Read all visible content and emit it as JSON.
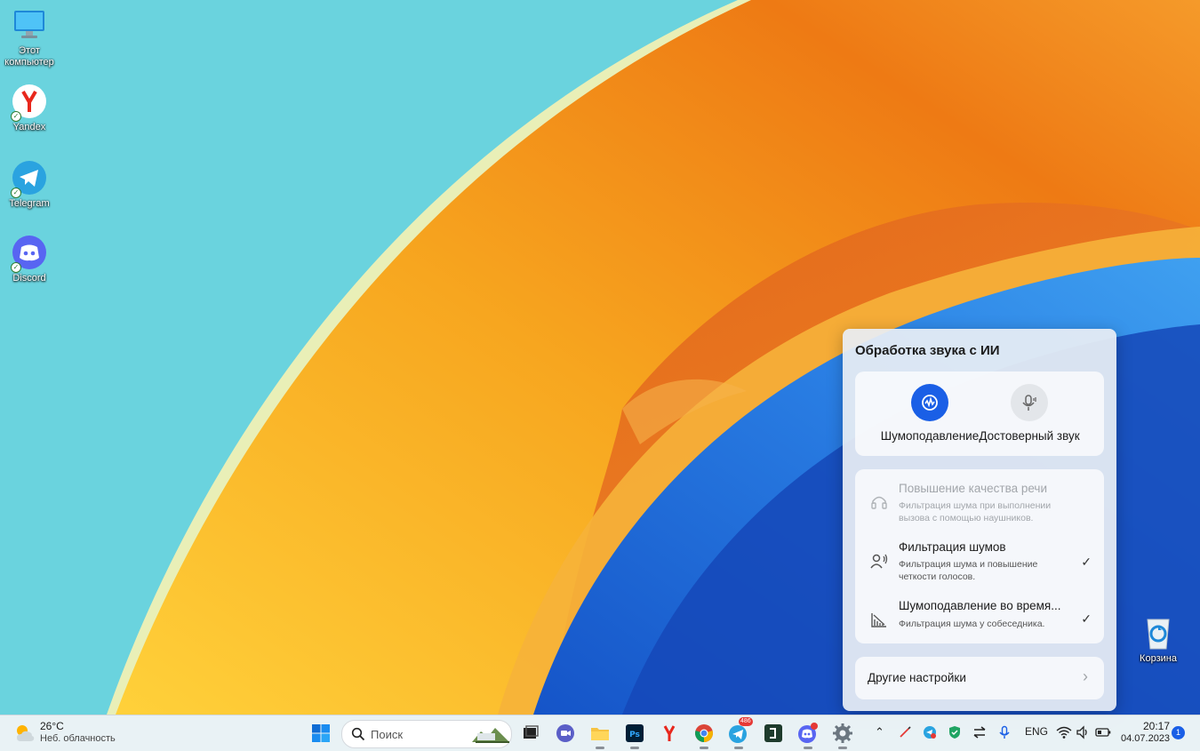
{
  "desktop": {
    "icons": [
      {
        "label": "Этот компьютер"
      },
      {
        "label": "Yandex"
      },
      {
        "label": "Telegram"
      },
      {
        "label": "Discord"
      },
      {
        "label": "Корзина"
      }
    ]
  },
  "panel": {
    "title": "Обработка звука с ИИ",
    "modes": [
      {
        "label": "Шумоподавление",
        "active": true
      },
      {
        "label": "Достоверный звук",
        "active": false
      }
    ],
    "options": [
      {
        "title": "Повышение качества речи",
        "desc": "Фильтрация шума при выполнении вызова с помощью наушников.",
        "enabled": false,
        "checked": false
      },
      {
        "title": "Фильтрация шумов",
        "desc": "Фильтрация шума и повышение четкости голосов.",
        "enabled": true,
        "checked": true
      },
      {
        "title": "Шумоподавление во время...",
        "desc": "Фильтрация шума у собеседника.",
        "enabled": true,
        "checked": true
      }
    ],
    "more_settings": "Другие настройки"
  },
  "taskbar": {
    "weather": {
      "temp": "26°C",
      "desc": "Неб. облачность"
    },
    "search_placeholder": "Поиск",
    "apps": [
      "task-view",
      "meet",
      "file-explorer",
      "photoshop",
      "yandex",
      "chrome",
      "telegram",
      "terminal",
      "discord",
      "settings"
    ],
    "telegram_badge": "486",
    "tray": {
      "language": "ENG"
    },
    "clock": {
      "time": "20:17",
      "date": "04.07.2023"
    },
    "notifications": "1"
  },
  "colors": {
    "accent": "#1a5fe6",
    "wallpaper_sky": "#6ad3de",
    "wallpaper_orange": "#f39a1e",
    "wallpaper_blue": "#1e6fd8"
  }
}
